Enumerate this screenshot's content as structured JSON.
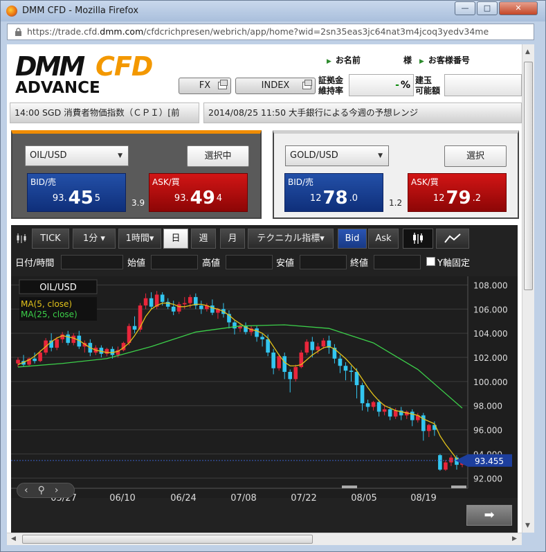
{
  "window": {
    "title": "DMM CFD - Mozilla Firefox",
    "min": "—",
    "max": "□",
    "close": "✕"
  },
  "address": {
    "prefix": "https://trade.cfd.",
    "domain": "dmm.com",
    "path": "/cfdcrichpresen/webrich/app/home?wid=2sn35eas3jc64nat3m4jcoq3yedv34me"
  },
  "logo": {
    "dmm": "DMM",
    "cfd": "CFD",
    "advance": "ADVANCE"
  },
  "nav": {
    "fx": "FX",
    "index": "INDEX"
  },
  "user": {
    "name_label": "お名前",
    "name_value": "様",
    "cust_label": "お客様番号"
  },
  "margin": {
    "label1": "証拠金",
    "label2": "維持率",
    "value": "%",
    "dash": "-"
  },
  "position": {
    "label1": "建玉",
    "label2": "可能額"
  },
  "news": [
    "14:00 SGD 消費者物価指数（ＣＰＩ）[前",
    "2014/08/25 11:50 大手銀行による今週の予想レンジ"
  ],
  "panels": [
    {
      "symbol": "OIL/USD",
      "button": "選択中",
      "bid": {
        "label": "BID/売",
        "pre": "93.",
        "big": "45",
        "post": "5"
      },
      "ask": {
        "label": "ASK/買",
        "pre": "93.",
        "big": "49",
        "post": "4"
      },
      "spread": "3.9"
    },
    {
      "symbol": "GOLD/USD",
      "button": "選択",
      "bid": {
        "label": "BID/売",
        "pre": "12",
        "big": "78",
        "post": ".0"
      },
      "ask": {
        "label": "ASK/買",
        "pre": "12",
        "big": "79",
        "post": ".2"
      },
      "spread": "1.2"
    }
  ],
  "toolbar": {
    "tick": "TICK",
    "min": "1分 ▾",
    "hour": "1時間▾",
    "day": "日",
    "week": "週",
    "month": "月",
    "tech": "テクニカル指標▾",
    "bid": "Bid",
    "ask": "Ask"
  },
  "fields": {
    "datetime": "日付/時間",
    "open": "始値",
    "high": "高値",
    "low": "安値",
    "close": "終値",
    "yfix": "Y軸固定"
  },
  "chart_data": {
    "type": "line",
    "title": "OIL/USD",
    "legend": [
      "MA(5, close)",
      "MA(25, close)"
    ],
    "yticks": [
      "108.000",
      "106.000",
      "104.000",
      "102.000",
      "100.000",
      "98.000",
      "96.000",
      "94.000",
      "92.000"
    ],
    "ylim": [
      91.5,
      108.6
    ],
    "xticks": [
      "05/27",
      "06/10",
      "06/24",
      "07/08",
      "07/22",
      "08/05",
      "08/19"
    ],
    "last_price": "93.455",
    "candles": [
      [
        101.5,
        102.0,
        101.8,
        101.2
      ],
      [
        101.7,
        102.2,
        101.4,
        101.2
      ],
      [
        101.4,
        102.0,
        101.9,
        101.3
      ],
      [
        101.9,
        102.4,
        101.7,
        101.5
      ],
      [
        101.7,
        102.6,
        102.4,
        101.6
      ],
      [
        102.4,
        103.6,
        103.4,
        102.2
      ],
      [
        103.4,
        104.0,
        102.8,
        102.5
      ],
      [
        102.8,
        103.7,
        103.5,
        102.6
      ],
      [
        103.5,
        104.1,
        103.9,
        103.2
      ],
      [
        103.9,
        104.2,
        103.2,
        103.0
      ],
      [
        103.2,
        104.0,
        103.8,
        103.0
      ],
      [
        103.8,
        104.2,
        102.9,
        102.7
      ],
      [
        102.9,
        103.4,
        103.2,
        102.4
      ],
      [
        103.2,
        103.5,
        102.4,
        102.1
      ],
      [
        102.4,
        103.0,
        102.8,
        102.2
      ],
      [
        102.8,
        103.0,
        102.3,
        102.0
      ],
      [
        102.3,
        102.8,
        102.7,
        102.1
      ],
      [
        102.7,
        102.9,
        102.2,
        101.9
      ],
      [
        102.2,
        102.9,
        102.6,
        102.0
      ],
      [
        102.6,
        103.3,
        103.2,
        102.5
      ],
      [
        103.2,
        104.8,
        104.6,
        103.0
      ],
      [
        104.6,
        105.4,
        104.3,
        104.0
      ],
      [
        104.3,
        106.5,
        106.3,
        104.1
      ],
      [
        106.3,
        107.3,
        106.9,
        106.0
      ],
      [
        106.9,
        107.4,
        106.2,
        106.0
      ],
      [
        106.2,
        107.5,
        107.2,
        106.0
      ],
      [
        107.2,
        107.4,
        106.6,
        106.3
      ],
      [
        106.6,
        106.9,
        106.2,
        106.0
      ],
      [
        106.2,
        106.7,
        105.8,
        105.5
      ],
      [
        105.8,
        106.6,
        106.4,
        105.6
      ],
      [
        106.4,
        107.0,
        106.5,
        106.0
      ],
      [
        106.5,
        107.2,
        107.0,
        106.1
      ],
      [
        107.0,
        107.3,
        106.3,
        106.0
      ],
      [
        106.3,
        106.7,
        106.0,
        105.6
      ],
      [
        106.0,
        106.5,
        106.3,
        105.8
      ],
      [
        106.3,
        106.8,
        105.7,
        105.5
      ],
      [
        105.7,
        106.1,
        106.0,
        105.2
      ],
      [
        106.0,
        106.5,
        105.6,
        105.3
      ],
      [
        105.6,
        105.9,
        104.9,
        104.4
      ],
      [
        104.9,
        105.1,
        104.4,
        103.9
      ],
      [
        104.4,
        104.8,
        104.6,
        104.1
      ],
      [
        104.6,
        104.9,
        104.1,
        103.9
      ],
      [
        104.1,
        104.6,
        104.4,
        103.8
      ],
      [
        104.4,
        104.6,
        103.7,
        103.3
      ],
      [
        103.7,
        104.0,
        103.5,
        102.9
      ],
      [
        103.5,
        103.9,
        102.4,
        102.1
      ],
      [
        102.4,
        102.7,
        101.1,
        100.6
      ],
      [
        101.1,
        102.3,
        102.1,
        100.9
      ],
      [
        102.1,
        102.4,
        100.8,
        100.2
      ],
      [
        100.8,
        101.0,
        100.2,
        99.1
      ],
      [
        100.2,
        101.4,
        101.2,
        100.0
      ],
      [
        101.2,
        102.6,
        102.4,
        101.1
      ],
      [
        102.4,
        103.5,
        103.3,
        102.2
      ],
      [
        103.3,
        103.7,
        102.6,
        102.0
      ],
      [
        102.6,
        103.2,
        102.9,
        102.3
      ],
      [
        102.9,
        103.6,
        103.4,
        102.7
      ],
      [
        103.4,
        103.8,
        102.8,
        102.3
      ],
      [
        102.8,
        103.1,
        101.9,
        101.5
      ],
      [
        101.9,
        102.2,
        101.3,
        100.7
      ],
      [
        101.3,
        101.6,
        100.9,
        100.1
      ],
      [
        100.9,
        101.3,
        100.8,
        100.0
      ],
      [
        100.8,
        101.1,
        99.7,
        98.6
      ],
      [
        99.7,
        99.9,
        98.2,
        97.6
      ],
      [
        98.2,
        98.5,
        97.9,
        97.5
      ],
      [
        97.9,
        98.4,
        98.3,
        97.6
      ],
      [
        98.3,
        98.5,
        97.5,
        97.1
      ],
      [
        97.5,
        98.1,
        97.7,
        97.2
      ],
      [
        97.7,
        97.9,
        97.1,
        96.8
      ],
      [
        97.1,
        97.8,
        97.6,
        96.9
      ],
      [
        97.6,
        97.9,
        97.2,
        96.8
      ],
      [
        97.2,
        97.6,
        97.5,
        96.9
      ],
      [
        97.5,
        97.7,
        96.8,
        96.3
      ],
      [
        96.8,
        97.4,
        97.2,
        96.6
      ],
      [
        97.2,
        97.4,
        95.9,
        95.1
      ],
      [
        95.9,
        96.5,
        96.4,
        95.4
      ],
      [
        96.4,
        96.7,
        96.0,
        95.5
      ],
      [
        93.9,
        94.0,
        92.7,
        92.6
      ],
      [
        92.7,
        93.5,
        93.3,
        92.6
      ],
      [
        93.3,
        93.9,
        93.7,
        93.0
      ],
      [
        93.7,
        93.9,
        93.1,
        92.7
      ],
      [
        93.1,
        93.6,
        93.4,
        92.9
      ]
    ],
    "ma5": [
      101.4,
      101.6,
      101.8,
      102.1,
      102.5,
      102.9,
      103.3,
      103.6,
      103.8,
      103.7,
      103.6,
      103.4,
      103.1,
      102.8,
      102.6,
      102.5,
      102.4,
      102.4,
      102.5,
      102.8,
      103.2,
      103.8,
      104.5,
      105.4,
      106.0,
      106.3,
      106.5,
      106.5,
      106.4,
      106.2,
      106.2,
      106.3,
      106.4,
      106.4,
      106.3,
      106.1,
      106.0,
      105.8,
      105.5,
      105.1,
      104.8,
      104.5,
      104.3,
      104.2,
      104.0,
      103.6,
      102.9,
      102.2,
      101.6,
      101.3,
      101.3,
      101.4,
      101.8,
      102.2,
      102.5,
      102.8,
      102.9,
      102.7,
      102.3,
      101.9,
      101.4,
      100.9,
      100.2,
      99.5,
      98.9,
      98.4,
      98.0,
      97.8,
      97.6,
      97.5,
      97.4,
      97.3,
      97.2,
      96.9,
      96.7,
      96.5,
      95.5,
      94.8,
      94.2,
      93.6,
      93.4
    ],
    "ma25_x": [
      0,
      8,
      16,
      24,
      32,
      40,
      48,
      56,
      64,
      72,
      80
    ],
    "ma25": [
      101.2,
      101.5,
      101.9,
      102.9,
      104.1,
      104.6,
      104.7,
      104.4,
      103.2,
      101.0,
      97.8
    ]
  },
  "colors": {
    "bull": "#e8263b",
    "bear": "#33c6f0",
    "ma5": "#e2c21a",
    "ma25": "#3cd04a",
    "accent": "#f08c00"
  }
}
